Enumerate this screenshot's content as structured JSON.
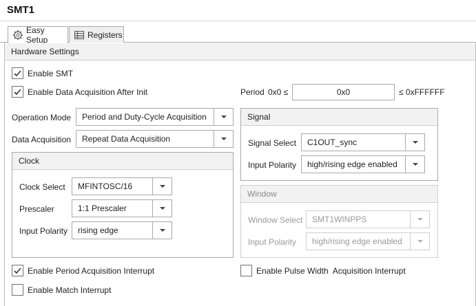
{
  "window": {
    "title": "SMT1"
  },
  "tabs": [
    {
      "label": "Easy Setup",
      "icon": "gear-icon",
      "active": true
    },
    {
      "label": "Registers",
      "icon": "table-icon",
      "active": false
    }
  ],
  "hardware_settings": {
    "header": "Hardware Settings",
    "enable_smt": {
      "label": "Enable SMT",
      "checked": true
    },
    "enable_data_acq": {
      "label": "Enable Data Acquisition After Init",
      "checked": true
    },
    "operation_mode": {
      "label": "Operation Mode",
      "value": "Period and Duty-Cycle Acquisition"
    },
    "data_acquisition": {
      "label": "Data Acquisition",
      "value": "Repeat Data Acquisition"
    },
    "period": {
      "label": "Period",
      "min": "0x0 ≤",
      "value": "0x0",
      "max": "≤ 0xFFFFFF"
    }
  },
  "clock": {
    "header": "Clock",
    "clock_select": {
      "label": "Clock Select",
      "value": "MFINTOSC/16"
    },
    "prescaler": {
      "label": "Prescaler",
      "value": "1:1 Prescaler"
    },
    "input_polarity": {
      "label": "Input Polarity",
      "value": "rising edge"
    }
  },
  "signal": {
    "header": "Signal",
    "signal_select": {
      "label": "Signal Select",
      "value": "C1OUT_sync"
    },
    "input_polarity": {
      "label": "Input Polarity",
      "value": "high/rising edge enabled"
    }
  },
  "window_panel": {
    "header": "Window",
    "window_select": {
      "label": "Window Select",
      "value": "SMT1WINPPS"
    },
    "input_polarity": {
      "label": "Input Polarity",
      "value": "high/rising edge enabled"
    }
  },
  "interrupts": {
    "period_acq": {
      "label": "Enable Period Acquisition Interrupt",
      "checked": true
    },
    "pulse_width": {
      "label": "Enable Pulse Width  Acquisition Interrupt",
      "checked": false
    },
    "match": {
      "label": "Enable Match Interrupt",
      "checked": false
    }
  },
  "colors": {
    "border": "#a9a9a9",
    "header_bg": "#f2f2f2",
    "disabled_text": "#9a9a9a"
  }
}
